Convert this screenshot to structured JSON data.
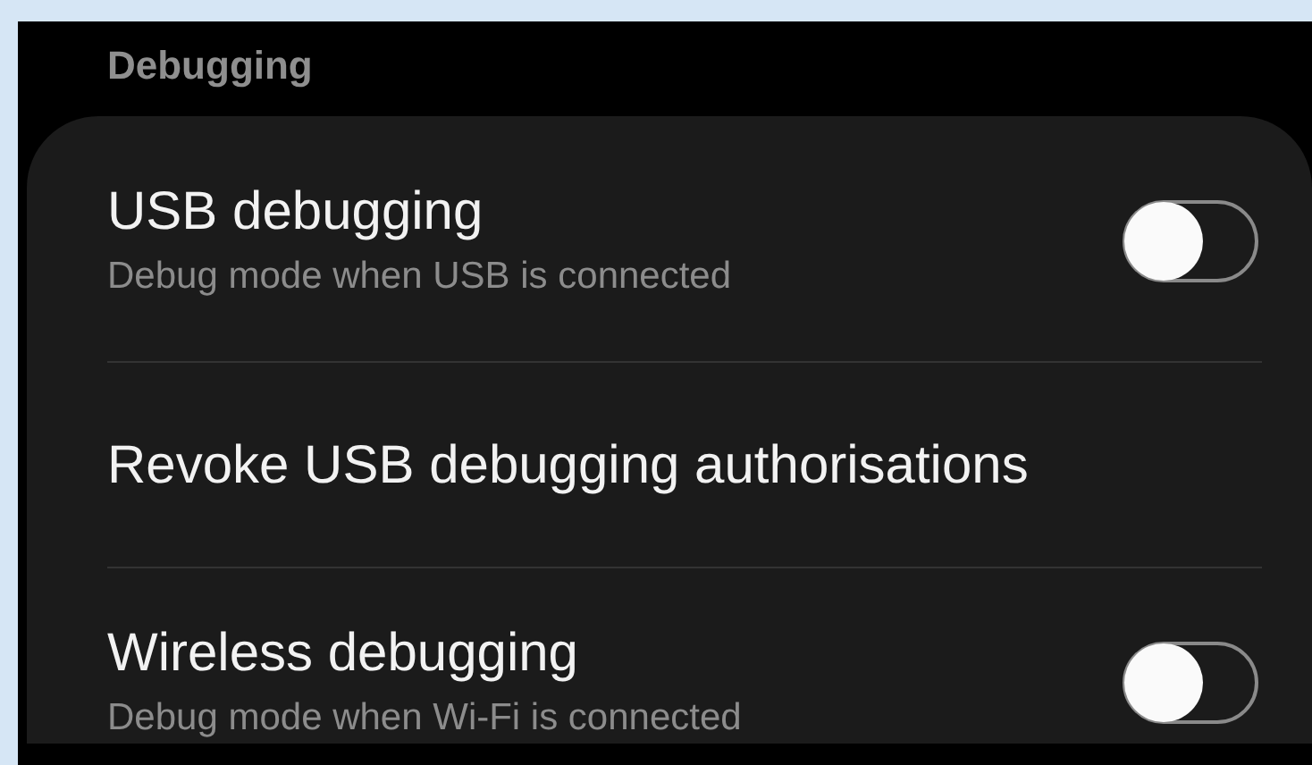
{
  "section": {
    "title": "Debugging"
  },
  "settings": [
    {
      "kind": "toggle",
      "title": "USB debugging",
      "subtitle": "Debug mode when USB is connected",
      "on": false
    },
    {
      "kind": "action",
      "title": "Revoke USB debugging authorisations"
    },
    {
      "kind": "toggle",
      "title": "Wireless debugging",
      "subtitle": "Debug mode when Wi-Fi is connected",
      "on": false
    }
  ]
}
